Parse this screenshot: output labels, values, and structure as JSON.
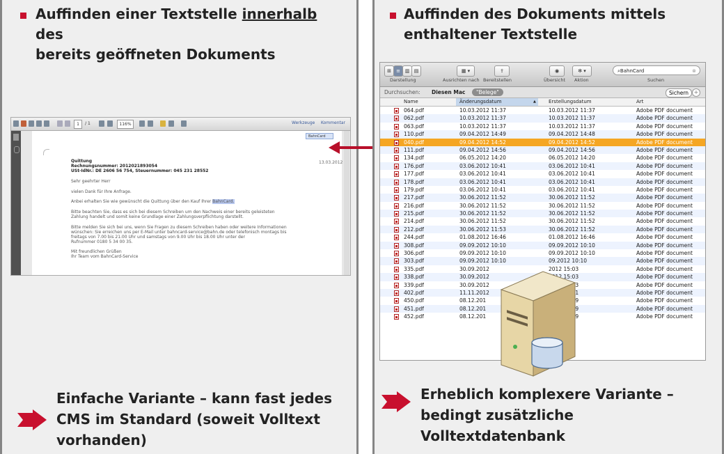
{
  "left": {
    "heading_line1_a": "Auffinden einer Textstelle ",
    "heading_line1_u": "innerhalb",
    "heading_line1_b": " des",
    "heading_line2": "bereits geöffneten Dokuments",
    "bottom_line1": "Einfache Variante – kann fast jedes",
    "bottom_line2": "CMS im Standard (soweit Volltext",
    "bottom_line3": "vorhanden)"
  },
  "right": {
    "heading_line1": "Auffinden des Dokuments mittels",
    "heading_line2": "enthaltener Textstelle",
    "bottom_line1": "Erheblich komplexere Variante –",
    "bottom_line2": "bedingt zusätzliche Volltextdatenbank"
  },
  "pdf_viewer": {
    "page_field": "1",
    "page_total": "/ 1",
    "zoom": "116%",
    "werkzeuge": "Werkzeuge",
    "kommentar": "Kommentar",
    "search_value": "BahnCard",
    "date": "13.03.2012",
    "lines": {
      "quittung": "Quittung",
      "rechnungsnummer": "Rechnungsnummer: 2012021893054",
      "ustid": "USt-IdNr.: DE 2606 56 754, Steuernummer: 045 231 28552",
      "anrede": "Sehr geehrter Herr",
      "dank": "vielen Dank für Ihre Anfrage.",
      "anbei_a": "Anbei erhalten Sie wie gewünscht die Quittung über den Kauf Ihrer ",
      "anbei_hl": "BahnCard.",
      "beachten1": "Bitte beachten Sie, dass es sich bei diesem Schreiben um den Nachweis einer bereits geleisteten",
      "beachten2": "Zahlung handelt und somit keine Grundlage einer Zahlungsverpflichtung darstellt.",
      "melden1": "Bitte melden Sie sich bei uns, wenn Sie Fragen zu diesem Schreiben haben oder weitere Informationen",
      "melden2": "wünschen: Sie erreichen uns per E-Mail unter bahncard-service@bahn.de oder telefonisch montags bis",
      "melden3": "freitags von 7.00 bis 21.00 Uhr und samstags von 9.00 Uhr bis 18.00 Uhr unter der",
      "melden4": "Rufnummer 0180 5 34 00 35.",
      "gruss1": "Mit freundlichen Grüßen",
      "gruss2": "Ihr Team vom BahnCard-Service"
    }
  },
  "finder": {
    "labels": {
      "darstellung": "Darstellung",
      "ausrichten": "Ausrichten nach",
      "bereitstellen": "Bereitstellen",
      "uebersicht": "Übersicht",
      "aktion": "Aktion",
      "suchen": "Suchen"
    },
    "search_value": "BahnCard",
    "scope_label": "Durchsuchen:",
    "scope_mac": "Diesen Mac",
    "scope_folder": "\"Belege\"",
    "save_button": "Sichern",
    "columns": [
      "Name",
      "Änderungsdatum",
      "Erstellungsdatum",
      "Art"
    ],
    "rows": [
      [
        "064.pdf",
        "10.03.2012 11:37",
        "10.03.2012 11:37",
        "Adobe PDF document"
      ],
      [
        "062.pdf",
        "10.03.2012 11:37",
        "10.03.2012 11:37",
        "Adobe PDF document"
      ],
      [
        "063.pdf",
        "10.03.2012 11:37",
        "10.03.2012 11:37",
        "Adobe PDF document"
      ],
      [
        "110.pdf",
        "09.04.2012 14:49",
        "09.04.2012 14:48",
        "Adobe PDF document"
      ],
      [
        "040.pdf",
        "09.04.2012 14:52",
        "09.04.2012 14:52",
        "Adobe PDF document"
      ],
      [
        "111.pdf",
        "09.04.2012 14:56",
        "09.04.2012 14:56",
        "Adobe PDF document"
      ],
      [
        "134.pdf",
        "06.05.2012 14:20",
        "06.05.2012 14:20",
        "Adobe PDF document"
      ],
      [
        "176.pdf",
        "03.06.2012 10:41",
        "03.06.2012 10:41",
        "Adobe PDF document"
      ],
      [
        "177.pdf",
        "03.06.2012 10:41",
        "03.06.2012 10:41",
        "Adobe PDF document"
      ],
      [
        "178.pdf",
        "03.06.2012 10:41",
        "03.06.2012 10:41",
        "Adobe PDF document"
      ],
      [
        "179.pdf",
        "03.06.2012 10:41",
        "03.06.2012 10:41",
        "Adobe PDF document"
      ],
      [
        "217.pdf",
        "30.06.2012 11:52",
        "30.06.2012 11:52",
        "Adobe PDF document"
      ],
      [
        "216.pdf",
        "30.06.2012 11:52",
        "30.06.2012 11:52",
        "Adobe PDF document"
      ],
      [
        "215.pdf",
        "30.06.2012 11:52",
        "30.06.2012 11:52",
        "Adobe PDF document"
      ],
      [
        "214.pdf",
        "30.06.2012 11:52",
        "30.06.2012 11:52",
        "Adobe PDF document"
      ],
      [
        "212.pdf",
        "30.06.2012 11:53",
        "30.06.2012 11:52",
        "Adobe PDF document"
      ],
      [
        "244.pdf",
        "01.08.2012 16:46",
        "01.08.2012 16:46",
        "Adobe PDF document"
      ],
      [
        "308.pdf",
        "09.09.2012 10:10",
        "09.09.2012 10:10",
        "Adobe PDF document"
      ],
      [
        "306.pdf",
        "09.09.2012 10:10",
        "09.09.2012 10:10",
        "Adobe PDF document"
      ],
      [
        "303.pdf",
        "09.09.2012 10:10",
        "09.2012 10:10",
        "Adobe PDF document"
      ],
      [
        "335.pdf",
        "30.09.2012",
        "2012 15:03",
        "Adobe PDF document"
      ],
      [
        "338.pdf",
        "30.09.2012",
        "2012 15:03",
        "Adobe PDF document"
      ],
      [
        "339.pdf",
        "30.09.2012",
        "2012 15:03",
        "Adobe PDF document"
      ],
      [
        "402.pdf",
        "11.11.2012",
        "2012 11:11",
        "Adobe PDF document"
      ],
      [
        "450.pdf",
        "08.12.201",
        "2012 11:59",
        "Adobe PDF document"
      ],
      [
        "451.pdf",
        "08.12.201",
        "2012 11:59",
        "Adobe PDF document"
      ],
      [
        "452.pdf",
        "08.12.201",
        "2012 11:59",
        "Adobe PDF document"
      ]
    ],
    "selected_row": 4
  },
  "colors": {
    "accent_red": "#c8102e",
    "selection_orange": "#f5a623",
    "sorted_column": "#c4d6ec"
  }
}
